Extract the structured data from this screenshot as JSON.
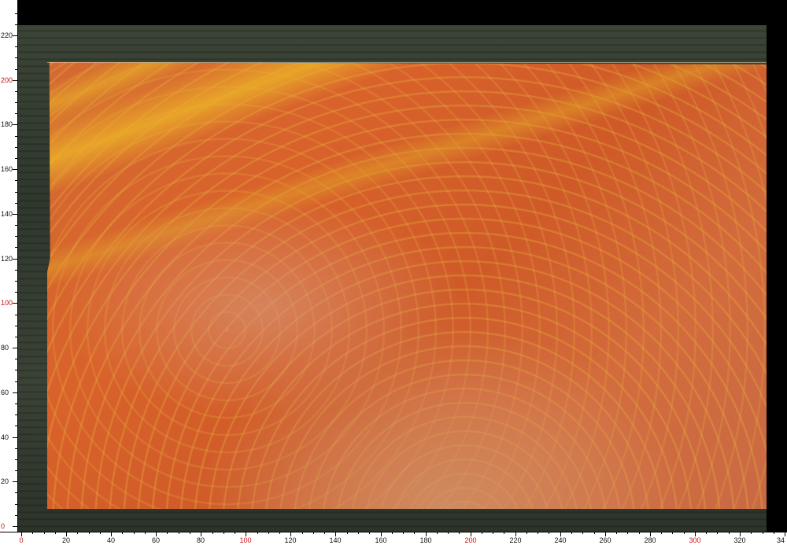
{
  "ruler": {
    "unit": "cm",
    "y_labels": [
      "220",
      "200",
      "180",
      "160",
      "140",
      "120",
      "100",
      "80",
      "60",
      "40",
      "20",
      "0"
    ],
    "x_labels": [
      "0",
      "20",
      "40",
      "60",
      "80",
      "100",
      "120",
      "140",
      "160",
      "180",
      "200",
      "220",
      "240",
      "260",
      "280",
      "300",
      "320",
      "34"
    ],
    "highlight_color": "#cc1111",
    "highlighted_values": [
      "0",
      "100",
      "200",
      "300"
    ]
  },
  "photo": {
    "subject": "marble slab",
    "colors": {
      "background": "#000000",
      "backdrop": "#343d31",
      "slab_base": "#d46a33",
      "veining": "#e8aa30"
    }
  }
}
